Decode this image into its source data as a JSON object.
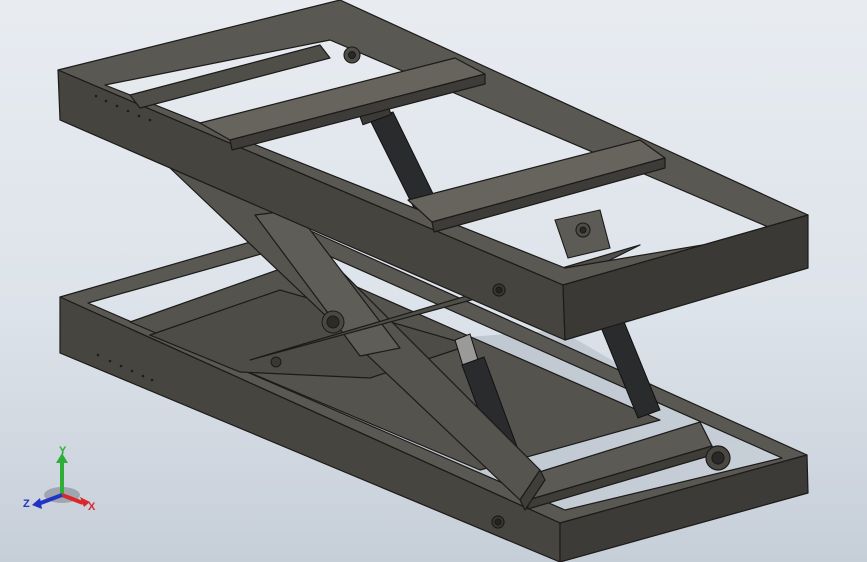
{
  "viewport": {
    "background_top": "#e8ecf1",
    "background_bottom": "#c6ced8",
    "model_color": "#4b4943",
    "edge_color": "#1c1b19"
  },
  "triad": {
    "x_label": "X",
    "y_label": "Y",
    "z_label": "Z",
    "x_color": "#d8282b",
    "y_color": "#2fae37",
    "z_color": "#2234c6"
  }
}
